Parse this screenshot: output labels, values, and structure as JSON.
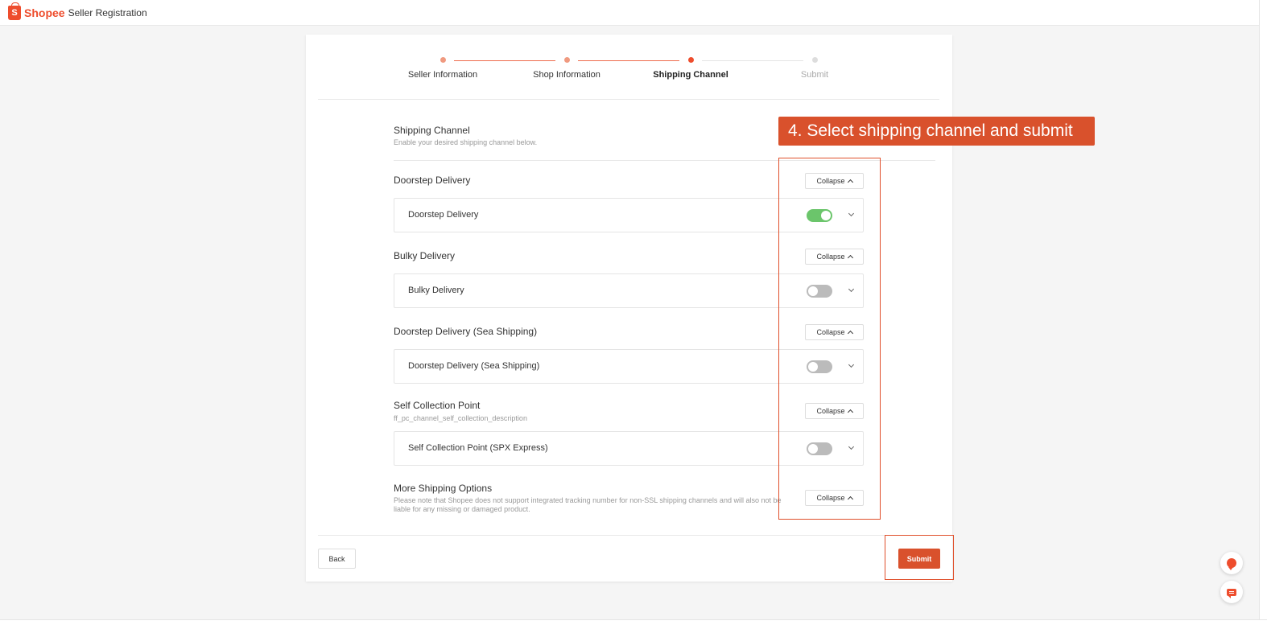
{
  "header": {
    "brand": "Shopee",
    "title": "Seller Registration"
  },
  "stepper": {
    "steps": [
      {
        "label": "Seller Information",
        "state": "done"
      },
      {
        "label": "Shop Information",
        "state": "done"
      },
      {
        "label": "Shipping Channel",
        "state": "active"
      },
      {
        "label": "Submit",
        "state": "pending"
      }
    ]
  },
  "shipping": {
    "title": "Shipping Channel",
    "description": "Enable your desired shipping channel below.",
    "sections": [
      {
        "title": "Doorstep Delivery",
        "description": "",
        "collapse_label": "Collapse",
        "channel": {
          "name": "Doorstep Delivery",
          "enabled": true
        }
      },
      {
        "title": "Bulky Delivery",
        "description": "",
        "collapse_label": "Collapse",
        "channel": {
          "name": "Bulky Delivery",
          "enabled": false
        }
      },
      {
        "title": "Doorstep Delivery (Sea Shipping)",
        "description": "",
        "collapse_label": "Collapse",
        "channel": {
          "name": "Doorstep Delivery (Sea Shipping)",
          "enabled": false
        }
      },
      {
        "title": "Self Collection Point",
        "description": "ff_pc_channel_self_collection_description",
        "collapse_label": "Collapse",
        "channel": {
          "name": "Self Collection Point (SPX Express)",
          "enabled": false
        }
      },
      {
        "title": "More Shipping Options",
        "description": "Please note that Shopee does not support integrated tracking number for non-SSL shipping channels and will also not be liable for any missing or damaged product.",
        "collapse_label": "Collapse"
      }
    ]
  },
  "footer": {
    "back_label": "Back",
    "submit_label": "Submit"
  },
  "annotation": {
    "text": "4. Select shipping channel and submit"
  },
  "colors": {
    "brand": "#ee4d2d",
    "toggle_on": "#6bc56b",
    "toggle_off": "#bbbbbb",
    "callout": "#d9512c"
  },
  "icons": [
    "shopee-logo-icon",
    "caret-up-icon",
    "chevron-down-icon",
    "help-bubble-icon",
    "chat-icon"
  ]
}
